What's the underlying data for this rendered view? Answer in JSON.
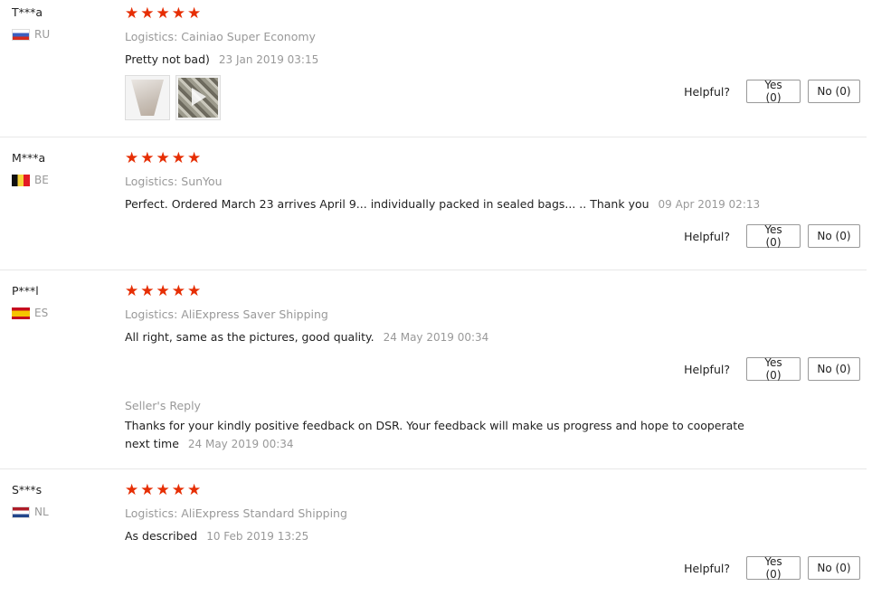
{
  "star_color": "#e62e04",
  "star_glyph": "★",
  "helpful_label": "Helpful?",
  "reviews": [
    {
      "user": "T***a",
      "country": "RU",
      "rating": 5,
      "logistics": "Logistics: Cainiao Super Economy",
      "text": "Pretty not bad)",
      "date": "23 Jan 2019 03:15",
      "yes": "Yes (0)",
      "no": "No (0)"
    },
    {
      "user": "M***a",
      "country": "BE",
      "rating": 5,
      "logistics": "Logistics: SunYou",
      "text": "Perfect. Ordered March 23 arrives April 9... individually packed in sealed bags... .. Thank you",
      "date": "09 Apr 2019 02:13",
      "yes": "Yes (0)",
      "no": "No (0)"
    },
    {
      "user": "P***l",
      "country": "ES",
      "rating": 5,
      "logistics": "Logistics: AliExpress Saver Shipping",
      "text": "All right, same as the pictures, good quality.",
      "date": "24 May 2019 00:34",
      "yes": "Yes (0)",
      "no": "No (0)",
      "seller_reply_label": "Seller's Reply",
      "seller_reply": "Thanks for your kindly positive feedback on DSR. Your feedback will make us progress and hope to cooperate next time",
      "seller_reply_date": "24 May 2019 00:34"
    },
    {
      "user": "S***s",
      "country": "NL",
      "rating": 5,
      "logistics": "Logistics: AliExpress Standard Shipping",
      "text": "As described",
      "date": "10 Feb 2019 13:25",
      "yes": "Yes (0)",
      "no": "No (0)"
    }
  ]
}
